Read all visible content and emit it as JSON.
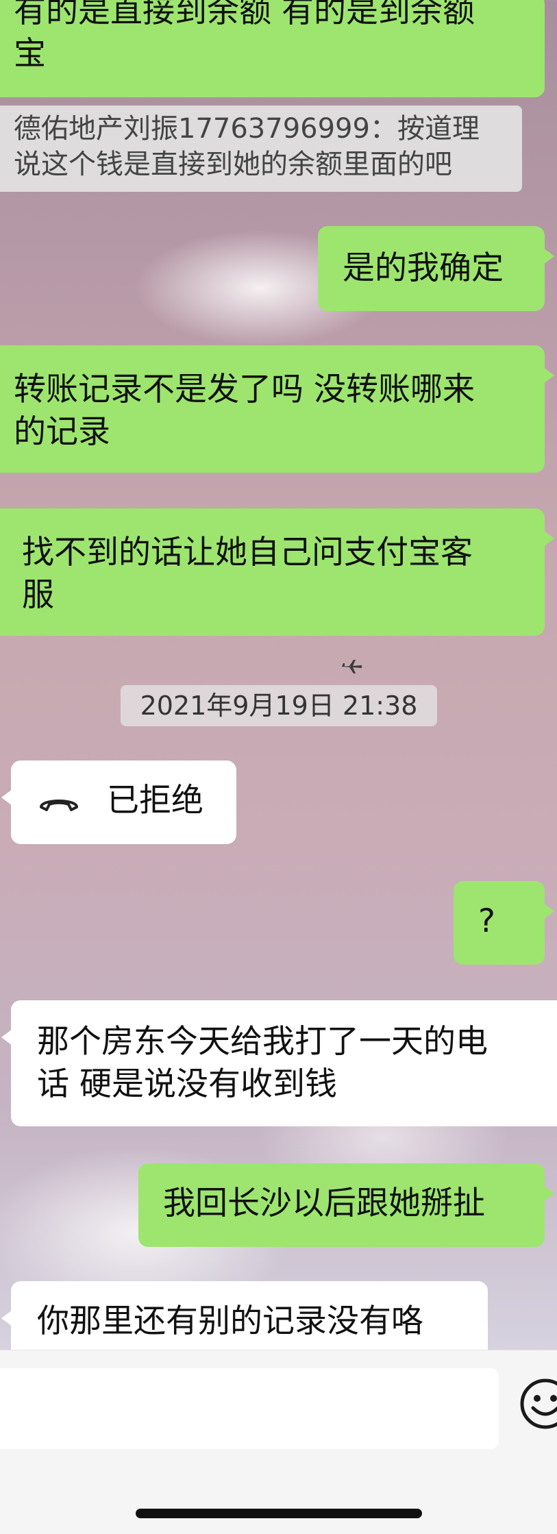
{
  "messages": {
    "m1": {
      "line1": "有的是直接到余额 有的是到余额",
      "line2": "宝"
    },
    "quote": {
      "line1": "德佑地产刘振17763796999：按道理",
      "line2": "说这个钱是直接到她的余额里面的吧"
    },
    "m2": {
      "text": "是的我确定"
    },
    "m3": {
      "line1": "转账记录不是发了吗 没转账哪来",
      "line2": "的记录"
    },
    "m4": {
      "line1": "找不到的话让她自己问支付宝客",
      "line2": "服"
    },
    "timestamp": "2021年9月19日 21:38",
    "call": {
      "status": "已拒绝",
      "icon": "phone-hangup-icon"
    },
    "m5": {
      "text": "?"
    },
    "m6": {
      "line1": "那个房东今天给我打了一天的电",
      "line2": "话 硬是说没有收到钱"
    },
    "m7": {
      "text": "我回长沙以后跟她掰扯"
    },
    "m8": {
      "text": "你那里还有别的记录没有咯"
    }
  },
  "input_bar": {
    "emoji_icon": "emoji-icon"
  },
  "colors": {
    "sent_bubble": "#9de56f",
    "received_bubble": "#ffffff"
  }
}
